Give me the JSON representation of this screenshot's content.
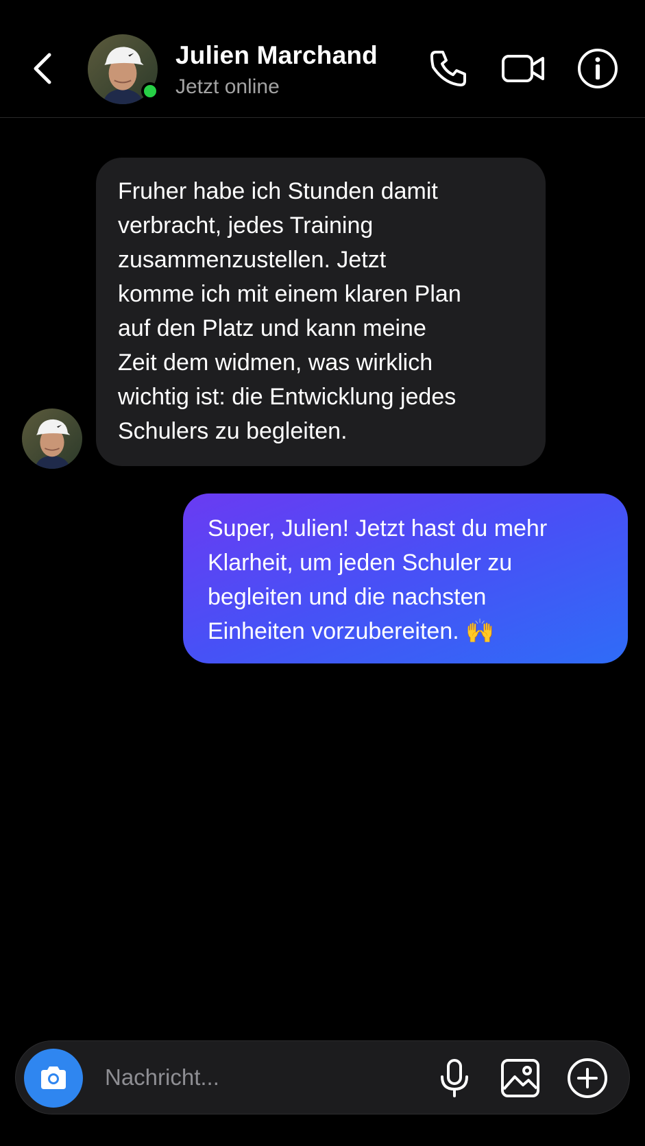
{
  "contact": {
    "name": "Julien Marchand",
    "status": "Jetzt online"
  },
  "messages": [
    {
      "direction": "incoming",
      "text": "Fruher habe ich Stunden damit\nverbracht, jedes Training\nzusammenzustellen. Jetzt\nkomme ich mit einem klaren Plan\nauf den Platz und kann meine\nZeit dem widmen, was wirklich\nwichtig ist: die Entwicklung jedes\nSchulers zu begleiten."
    },
    {
      "direction": "outgoing",
      "text": "Super, Julien! Jetzt hast du mehr\nKlarheit, um jeden Schuler zu\nbegleiten und die nachsten\nEinheiten vorzubereiten. 🙌"
    }
  ],
  "composer": {
    "placeholder": "Nachricht..."
  },
  "icons": {
    "header": [
      "back-chevron-icon",
      "phone-icon",
      "video-camera-icon",
      "info-icon"
    ],
    "composer": [
      "camera-icon",
      "microphone-icon",
      "image-icon",
      "plus-circle-icon"
    ]
  },
  "colors": {
    "background": "#000000",
    "incoming_bubble": "#1e1e20",
    "outgoing_gradient_start": "#6a3bf2",
    "outgoing_gradient_end": "#2f6cf7",
    "online_indicator": "#27d046",
    "camera_button": "#2f86f0"
  }
}
